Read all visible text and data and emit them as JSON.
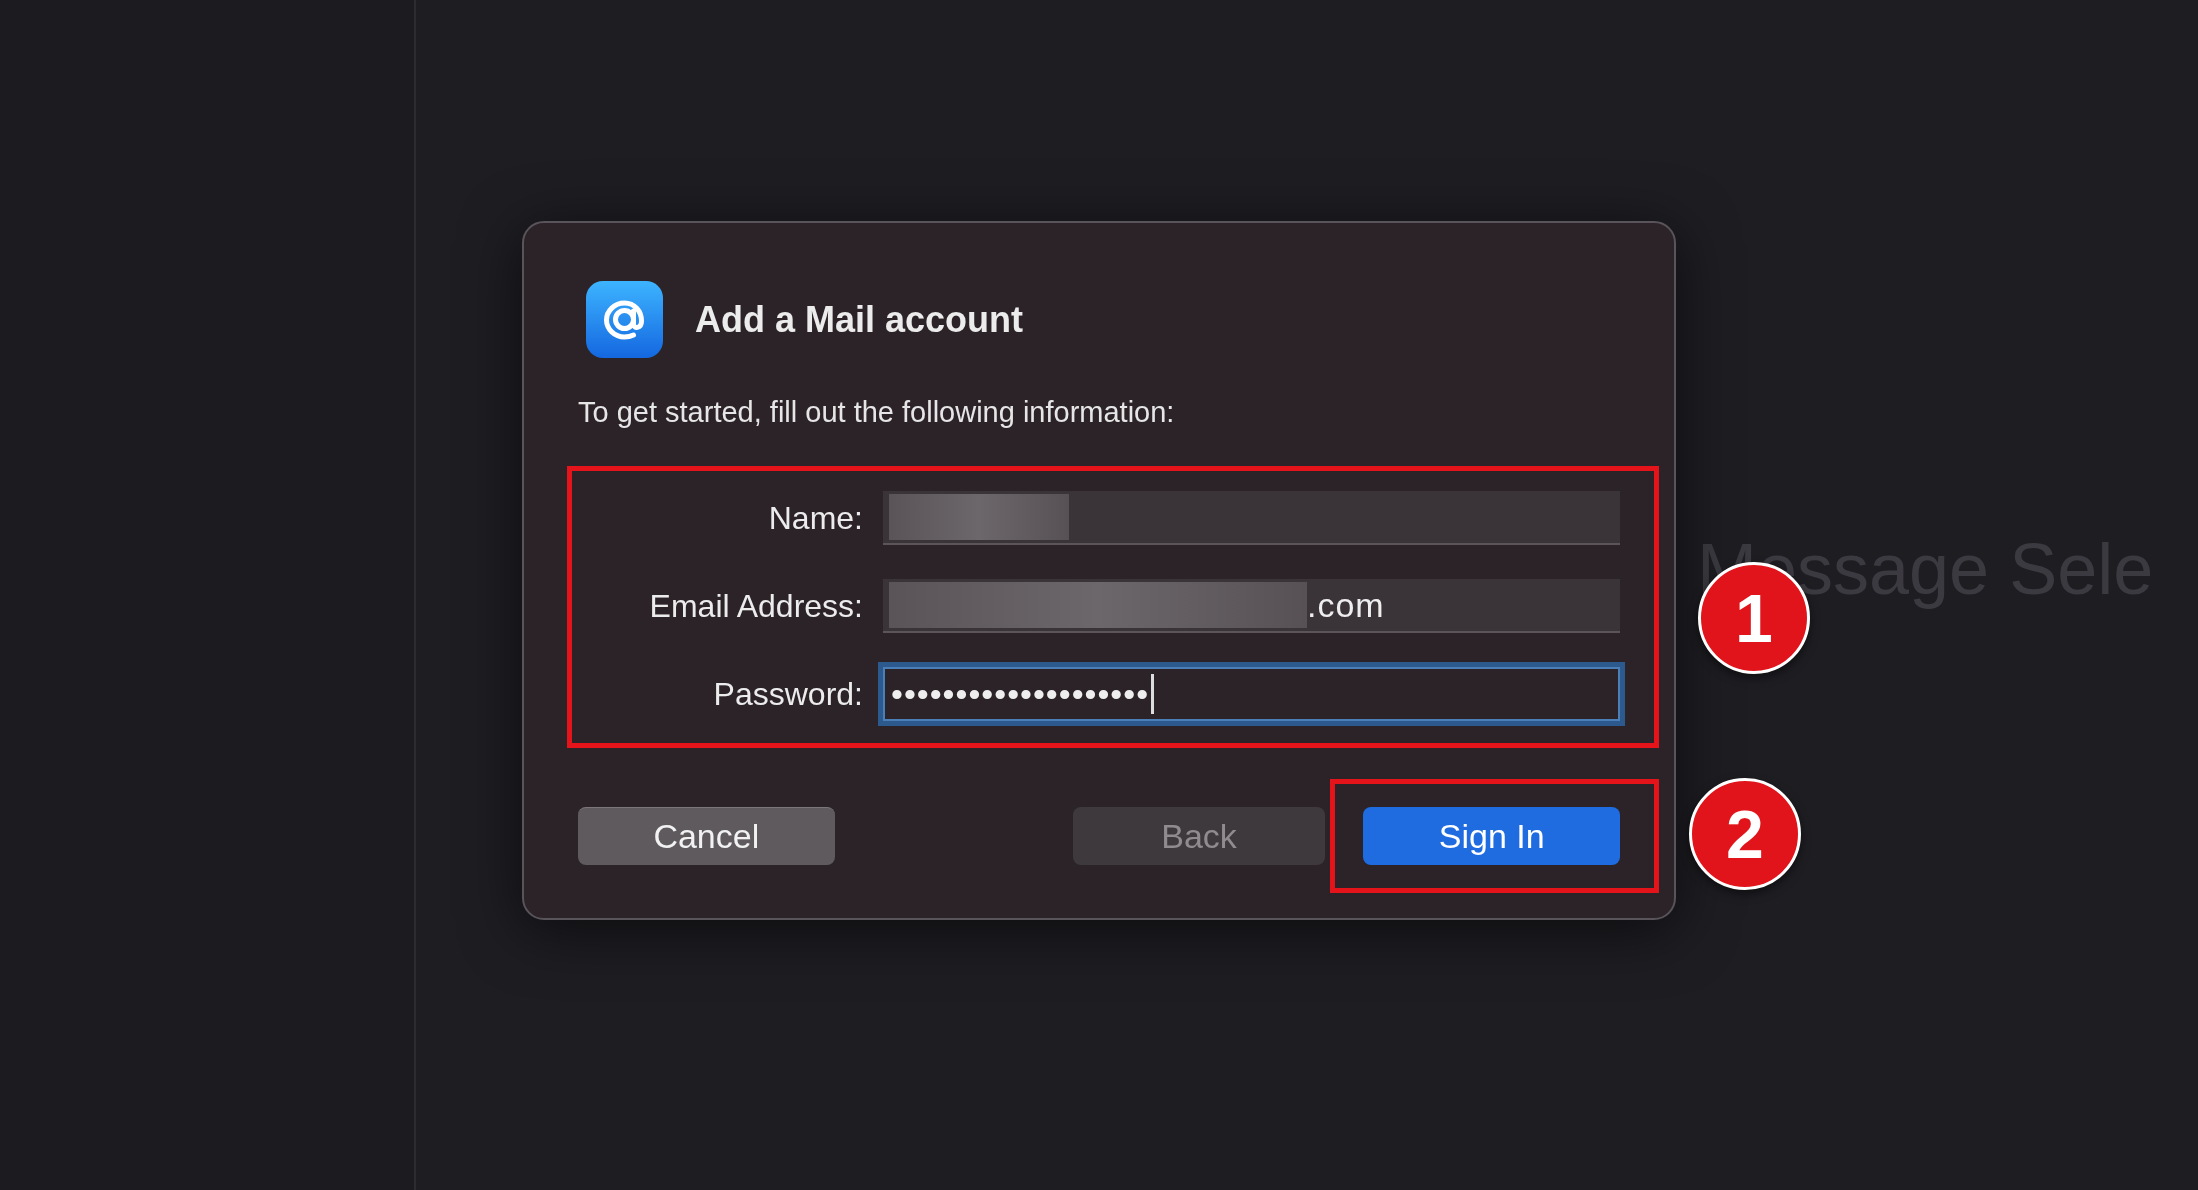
{
  "background_text": "Message Sele",
  "dialog": {
    "title": "Add a Mail account",
    "subtitle": "To get started, fill out the following information:",
    "fields": [
      {
        "label": "Name:",
        "redacted": true,
        "focused": false
      },
      {
        "label": "Email Address:",
        "value": ".com",
        "redacted": true,
        "focused": false
      },
      {
        "label": "Password:",
        "value": "••••••••••••••••••••",
        "redacted": false,
        "focused": true
      }
    ],
    "buttons": [
      {
        "label": "Cancel",
        "kind": "secondary",
        "disabled": false
      },
      {
        "label": "Back",
        "kind": "secondary",
        "disabled": true
      },
      {
        "label": "Sign In",
        "kind": "primary",
        "disabled": false
      }
    ]
  },
  "annotations": [
    {
      "label": "1"
    },
    {
      "label": "2"
    }
  ]
}
